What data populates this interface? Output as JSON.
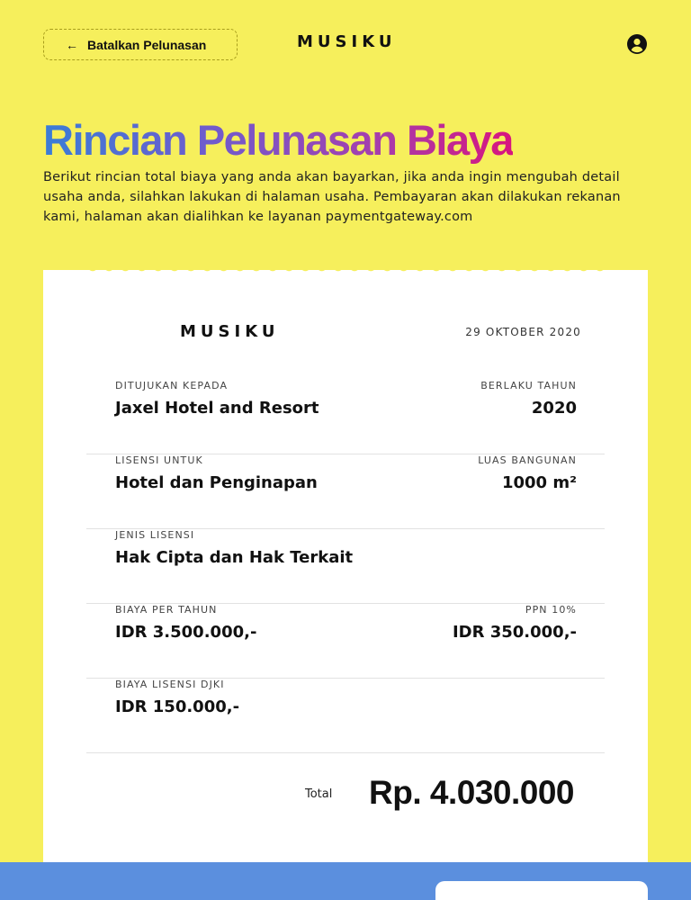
{
  "header": {
    "back_label": "Batalkan Pelunasan",
    "brand": "MUSIKU"
  },
  "page": {
    "title": "Rincian Pelunasan Biaya",
    "description": "Berikut rincian total biaya yang anda akan bayarkan, jika anda ingin mengubah detail usaha anda, silahkan lakukan di halaman usaha. Pembayaran akan dilakukan rekanan kami, halaman akan dialihkan ke layanan paymentgateway.com"
  },
  "receipt": {
    "brand": "MUSIKU",
    "date": "29 OKTOBER 2020",
    "rows": [
      {
        "left": {
          "label": "DITUJUKAN KEPADA",
          "value": "Jaxel Hotel and Resort"
        },
        "right": {
          "label": "BERLAKU TAHUN",
          "value": "2020"
        }
      },
      {
        "left": {
          "label": "LISENSI UNTUK",
          "value": "Hotel dan Penginapan"
        },
        "right": {
          "label": "LUAS BANGUNAN",
          "value": "1000 m²"
        }
      },
      {
        "left": {
          "label": "JENIS LISENSI",
          "value": "Hak Cipta dan Hak Terkait"
        }
      },
      {
        "left": {
          "label": "BIAYA PER TAHUN",
          "value": "IDR 3.500.000,-"
        },
        "right": {
          "label": "PPN 10%",
          "value": "IDR 350.000,-"
        }
      },
      {
        "left": {
          "label": "BIAYA LISENSI DJKI",
          "value": "IDR 150.000,-"
        }
      }
    ],
    "total_label": "Total",
    "total_value": "Rp. 4.030.000"
  },
  "colors": {
    "background": "#f6ef5c",
    "title_gradient": [
      "#3a7dd6",
      "#6f5ccd",
      "#a43fae",
      "#d8157e"
    ],
    "bottom_band": "#5b8fde"
  },
  "icons": {
    "back": "arrow-left-icon",
    "account": "user-account-icon"
  }
}
